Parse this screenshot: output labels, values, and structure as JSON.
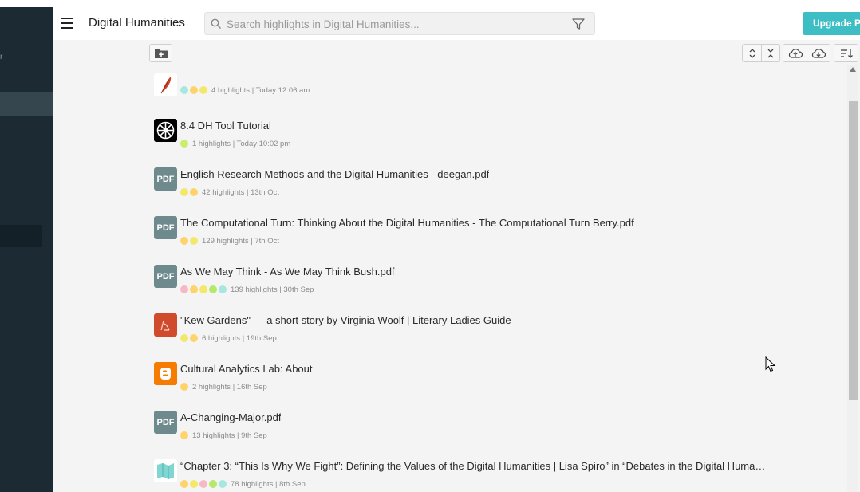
{
  "header": {
    "title": "Digital Humanities",
    "search_placeholder": "Search highlights in Digital Humanities...",
    "upgrade_label": "Upgrade P"
  },
  "sidebar": {
    "fragment": "r"
  },
  "colors": {
    "sidebar": "#1b2a33",
    "accent": "#3dbdc4",
    "pdf_badge": "#6e8a8d"
  },
  "items": [
    {
      "title": "",
      "thumb": "feather-icon",
      "dots": [
        "#a6e8e0",
        "#ffd36b",
        "#f4e86b"
      ],
      "meta": "4 highlights | Today 12:06 am"
    },
    {
      "title": "8.4 DH Tool Tutorial",
      "thumb": "wheel-icon",
      "dots": [
        "#c8ee6a"
      ],
      "meta": "1 highlights | Today 10:02 pm"
    },
    {
      "title": "English Research Methods and the Digital Humanities - deegan.pdf",
      "thumb": "pdf",
      "thumb_label": "PDF",
      "dots": [
        "#f4e86b",
        "#ffd36b"
      ],
      "meta": "42 highlights | 13th Oct"
    },
    {
      "title": "The Computational Turn: Thinking About the Digital Humanities - The Computational Turn Berry.pdf",
      "thumb": "pdf",
      "thumb_label": "PDF",
      "dots": [
        "#ffd36b",
        "#f4e86b"
      ],
      "meta": "129 highlights | 7th Oct"
    },
    {
      "title": "As We May Think - As We May Think Bush.pdf",
      "thumb": "pdf",
      "thumb_label": "PDF",
      "dots": [
        "#f7b8c6",
        "#ffd36b",
        "#f4e86b",
        "#b6e86a",
        "#a6e8e0"
      ],
      "meta": "139 highlights | 30th Sep"
    },
    {
      "title": "\"Kew Gardens\" — a short story by Virginia Woolf | Literary Ladies Guide",
      "thumb": "pen-icon",
      "dots": [
        "#f4e86b",
        "#ffd36b"
      ],
      "meta": "6 highlights | 19th Sep"
    },
    {
      "title": "Cultural Analytics Lab: About",
      "thumb": "blogger-icon",
      "dots": [
        "#ffd36b"
      ],
      "meta": "2 highlights | 16th Sep"
    },
    {
      "title": "A-Changing-Major.pdf",
      "thumb": "pdf",
      "thumb_label": "PDF",
      "dots": [
        "#ffd36b"
      ],
      "meta": "13 highlights | 9th Sep"
    },
    {
      "title": "“Chapter 3: “This Is Why We Fight”: Defining the Values of the Digital Humanities | Lisa Spiro” in “Debates in the Digital Humani...",
      "thumb": "map-icon",
      "dots": [
        "#ffd36b",
        "#f4e86b",
        "#f7b8c6",
        "#b6e86a",
        "#a6e8e0"
      ],
      "meta": "78 highlights | 8th Sep"
    }
  ]
}
